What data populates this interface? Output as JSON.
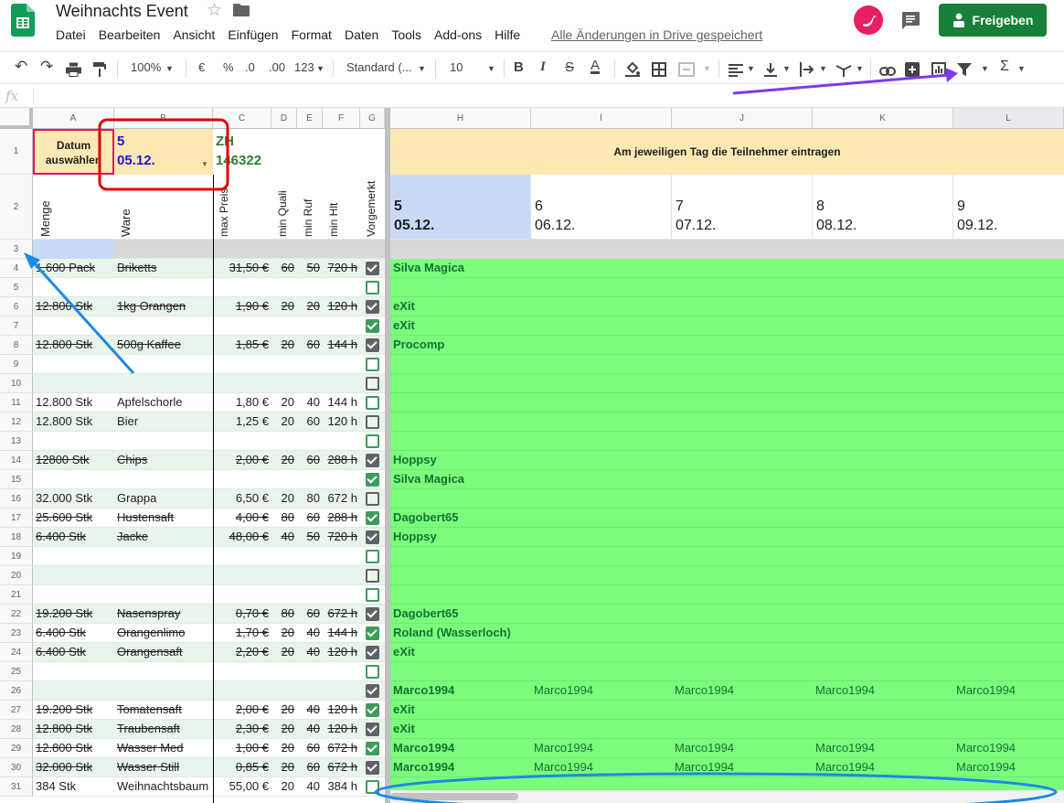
{
  "app": {
    "title": "Weihnachts Event",
    "saved_status": "Alle Änderungen in Drive gespeichert",
    "share_label": "Freigeben"
  },
  "menu": [
    "Datei",
    "Bearbeiten",
    "Ansicht",
    "Einfügen",
    "Format",
    "Daten",
    "Tools",
    "Add-ons",
    "Hilfe"
  ],
  "toolbar": {
    "zoom": "100%",
    "currency": "€",
    "percent": "%",
    "dec_less": ".0",
    "dec_more": ".00",
    "more_formats": "123",
    "font": "Standard (...",
    "font_size": "10",
    "bold": "B",
    "italic": "I",
    "strike": "S",
    "text_color": "A",
    "sum": "Σ"
  },
  "formula_bar": {
    "fx": "fx"
  },
  "columns": [
    "A",
    "B",
    "C",
    "D",
    "E",
    "F",
    "G",
    "H",
    "I",
    "J",
    "K",
    "L"
  ],
  "selector": {
    "label": "Datum auswählen",
    "day": "5",
    "date": "05.12.",
    "code_label": "ZH",
    "code_value": "146322"
  },
  "banner": "Am jeweiligen Tag die Teilnehmer eintragen",
  "headers": {
    "menge": "Menge",
    "ware": "Ware",
    "max_preis": "max Preis",
    "min_quali": "min Quali",
    "min_ruf": "min Ruf",
    "min_hlt": "min Hlt",
    "vorgemerkt": "Vorgemerkt"
  },
  "days": [
    {
      "num": "5",
      "date": "05.12."
    },
    {
      "num": "6",
      "date": "06.12."
    },
    {
      "num": "7",
      "date": "07.12."
    },
    {
      "num": "8",
      "date": "08.12."
    },
    {
      "num": "9",
      "date": "09.12."
    }
  ],
  "rows": [
    {
      "n": "3",
      "menge": "",
      "ware": "",
      "preis": "",
      "q": "",
      "r": "",
      "h": "",
      "chk": null,
      "strike": false,
      "p": ""
    },
    {
      "n": "4",
      "menge": "1.600 Pack",
      "ware": "Briketts",
      "preis": "31,50 €",
      "q": "60",
      "r": "50",
      "h": "720 h",
      "chk": "on",
      "strike": true,
      "p": "Silva Magica"
    },
    {
      "n": "5",
      "menge": "",
      "ware": "",
      "preis": "",
      "q": "",
      "r": "",
      "h": "",
      "chk": "off-g",
      "strike": false,
      "p": ""
    },
    {
      "n": "6",
      "menge": "12.800 Stk",
      "ware": "1kg Orangen",
      "preis": "1,90 €",
      "q": "20",
      "r": "20",
      "h": "120 h",
      "chk": "on",
      "strike": true,
      "p": "eXit"
    },
    {
      "n": "7",
      "menge": "",
      "ware": "",
      "preis": "",
      "q": "",
      "r": "",
      "h": "",
      "chk": "on-g",
      "strike": false,
      "p": "eXit"
    },
    {
      "n": "8",
      "menge": "12.800 Stk",
      "ware": "500g Kaffee",
      "preis": "1,85 €",
      "q": "20",
      "r": "60",
      "h": "144 h",
      "chk": "on",
      "strike": true,
      "p": "Procomp"
    },
    {
      "n": "9",
      "menge": "",
      "ware": "",
      "preis": "",
      "q": "",
      "r": "",
      "h": "",
      "chk": "off-g",
      "strike": false,
      "p": ""
    },
    {
      "n": "10",
      "menge": "",
      "ware": "",
      "preis": "",
      "q": "",
      "r": "",
      "h": "",
      "chk": "off",
      "strike": false,
      "p": ""
    },
    {
      "n": "11",
      "menge": "12.800 Stk",
      "ware": "Apfelschorle",
      "preis": "1,80 €",
      "q": "20",
      "r": "40",
      "h": "144 h",
      "chk": "off-g",
      "strike": false,
      "p": ""
    },
    {
      "n": "12",
      "menge": "12.800 Stk",
      "ware": "Bier",
      "preis": "1,25 €",
      "q": "20",
      "r": "60",
      "h": "120 h",
      "chk": "off",
      "strike": false,
      "p": ""
    },
    {
      "n": "13",
      "menge": "",
      "ware": "",
      "preis": "",
      "q": "",
      "r": "",
      "h": "",
      "chk": "off-g",
      "strike": false,
      "p": ""
    },
    {
      "n": "14",
      "menge": "12800 Stk",
      "ware": "Chips",
      "preis": "2,00 €",
      "q": "20",
      "r": "60",
      "h": "288 h",
      "chk": "on",
      "strike": true,
      "p": "Hoppsy"
    },
    {
      "n": "15",
      "menge": "",
      "ware": "",
      "preis": "",
      "q": "",
      "r": "",
      "h": "",
      "chk": "on-g",
      "strike": false,
      "p": "Silva Magica"
    },
    {
      "n": "16",
      "menge": "32.000 Stk",
      "ware": "Grappa",
      "preis": "6,50 €",
      "q": "20",
      "r": "80",
      "h": "672 h",
      "chk": "off",
      "strike": false,
      "p": ""
    },
    {
      "n": "17",
      "menge": "25.600 Stk",
      "ware": "Hustensaft",
      "preis": "4,00 €",
      "q": "80",
      "r": "60",
      "h": "288 h",
      "chk": "on-g",
      "strike": true,
      "p": "Dagobert65"
    },
    {
      "n": "18",
      "menge": "6.400 Stk",
      "ware": "Jacke",
      "preis": "48,00 €",
      "q": "40",
      "r": "50",
      "h": "720 h",
      "chk": "on",
      "strike": true,
      "p": "Hoppsy"
    },
    {
      "n": "19",
      "menge": "",
      "ware": "",
      "preis": "",
      "q": "",
      "r": "",
      "h": "",
      "chk": "off-g",
      "strike": false,
      "p": ""
    },
    {
      "n": "20",
      "menge": "",
      "ware": "",
      "preis": "",
      "q": "",
      "r": "",
      "h": "",
      "chk": "off",
      "strike": false,
      "p": ""
    },
    {
      "n": "21",
      "menge": "",
      "ware": "",
      "preis": "",
      "q": "",
      "r": "",
      "h": "",
      "chk": "off-g",
      "strike": false,
      "p": ""
    },
    {
      "n": "22",
      "menge": "19.200 Stk",
      "ware": "Nasenspray",
      "preis": "0,70 €",
      "q": "80",
      "r": "60",
      "h": "672 h",
      "chk": "on",
      "strike": true,
      "p": "Dagobert65"
    },
    {
      "n": "23",
      "menge": "6.400 Stk",
      "ware": "Orangenlimo",
      "preis": "1,70 €",
      "q": "20",
      "r": "40",
      "h": "144 h",
      "chk": "on-g",
      "strike": true,
      "p": "Roland (Wasserloch)"
    },
    {
      "n": "24",
      "menge": "6.400 Stk",
      "ware": "Orangensaft",
      "preis": "2,20 €",
      "q": "20",
      "r": "40",
      "h": "120 h",
      "chk": "on",
      "strike": true,
      "p": "eXit"
    },
    {
      "n": "25",
      "menge": "",
      "ware": "",
      "preis": "",
      "q": "",
      "r": "",
      "h": "",
      "chk": "off-g",
      "strike": false,
      "p": ""
    },
    {
      "n": "26",
      "menge": "",
      "ware": "",
      "preis": "",
      "q": "",
      "r": "",
      "h": "",
      "chk": "on",
      "strike": false,
      "p": "Marco1994",
      "extra": [
        "Marco1994",
        "Marco1994",
        "Marco1994",
        "Marco1994"
      ]
    },
    {
      "n": "27",
      "menge": "19.200 Stk",
      "ware": "Tomatensaft",
      "preis": "2,00 €",
      "q": "20",
      "r": "40",
      "h": "120 h",
      "chk": "on-g",
      "strike": true,
      "p": "eXit"
    },
    {
      "n": "28",
      "menge": "12.800 Stk",
      "ware": "Traubensaft",
      "preis": "2,30 €",
      "q": "20",
      "r": "40",
      "h": "120 h",
      "chk": "on",
      "strike": true,
      "p": "eXit"
    },
    {
      "n": "29",
      "menge": "12.800 Stk",
      "ware": "Wasser Med",
      "preis": "1,00 €",
      "q": "20",
      "r": "60",
      "h": "672 h",
      "chk": "on-g",
      "strike": true,
      "p": "Marco1994",
      "extra": [
        "Marco1994",
        "Marco1994",
        "Marco1994",
        "Marco1994"
      ]
    },
    {
      "n": "30",
      "menge": "32.000 Stk",
      "ware": "Wasser Still",
      "preis": "0,85 €",
      "q": "20",
      "r": "60",
      "h": "672 h",
      "chk": "on",
      "strike": true,
      "p": "Marco1994",
      "extra": [
        "Marco1994",
        "Marco1994",
        "Marco1994",
        "Marco1994"
      ]
    },
    {
      "n": "31",
      "menge": "384 Stk",
      "ware": "Weihnachtsbaum",
      "preis": "55,00 €",
      "q": "20",
      "r": "40",
      "h": "384 h",
      "chk": "off-g",
      "strike": false,
      "p": ""
    }
  ],
  "row_labels": {
    "r1": "1",
    "r2": "2"
  },
  "colors": {
    "green_fill": "#7cfc7c",
    "header_fill": "#fce8b2",
    "accent_green": "#188038",
    "annotation_blue": "#1e88e5",
    "annotation_purple": "#7c3aed",
    "annotation_red": "#e00000"
  }
}
